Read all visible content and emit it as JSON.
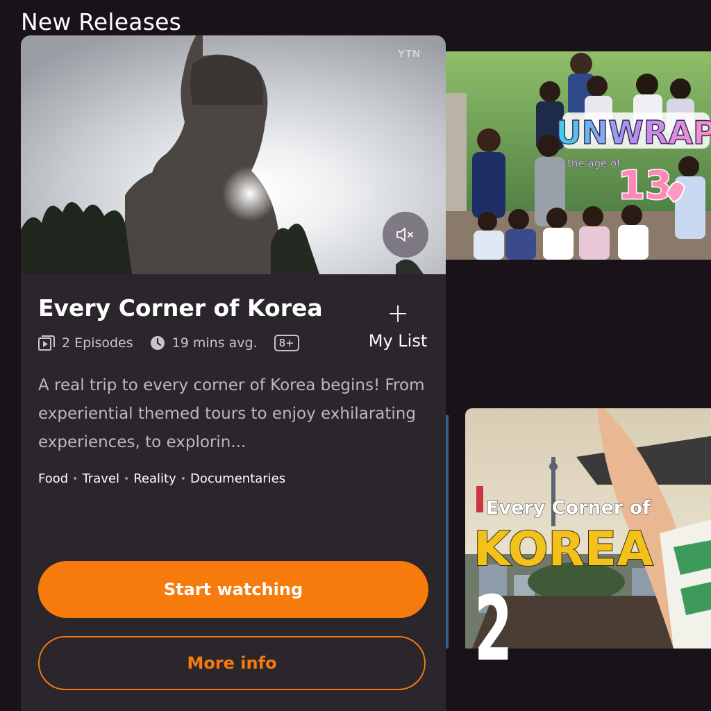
{
  "section": {
    "title": "New Releases"
  },
  "featured": {
    "hero_watermark": "YTN",
    "title": "Every Corner of Korea",
    "episodes": "2 Episodes",
    "duration": "19 mins avg.",
    "rating": "8+",
    "my_list_label": "My List",
    "description": "A real trip to every corner of Korea begins! From experiential themed tours to enjoy exhilarating experiences, to explorin...",
    "genres": [
      "Food",
      "Travel",
      "Reality",
      "Documentaries"
    ],
    "start_label": "Start watching",
    "more_label": "More info",
    "colors": {
      "accent": "#f77a0c",
      "card_bg": "#2a262c",
      "page_bg": "#191319"
    }
  },
  "tiles": {
    "unwrap": {
      "title_line1": "UNWRAP",
      "subtitle": "the age of",
      "number": "13"
    },
    "korea": {
      "title_line1": "Every Corner of",
      "title_line2": "KOREA",
      "rank": "2"
    }
  }
}
